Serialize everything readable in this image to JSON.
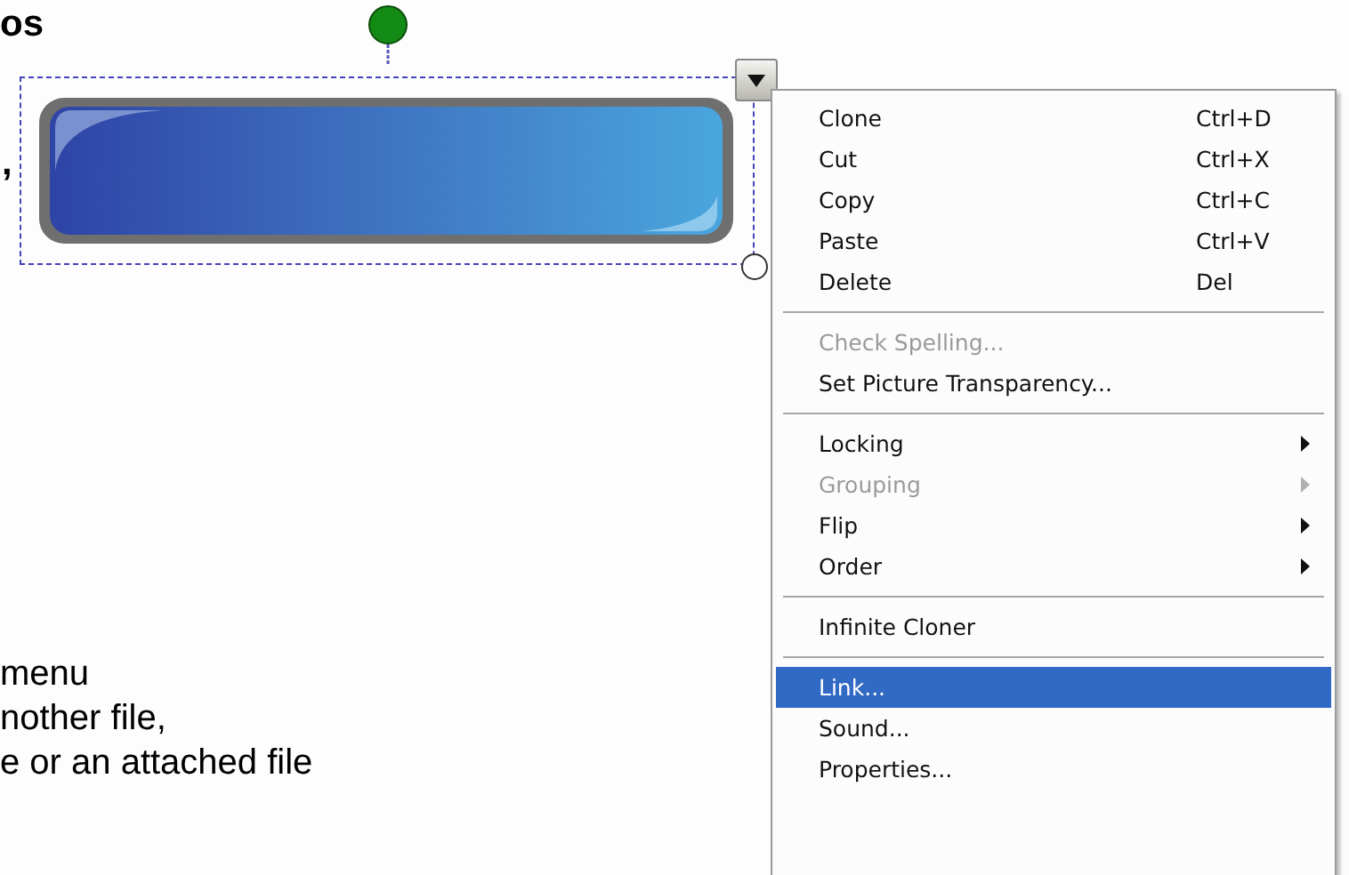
{
  "slide": {
    "texts": [
      {
        "kind": "heading",
        "text": "os"
      },
      {
        "kind": "fragment",
        "text": ","
      },
      {
        "kind": "body",
        "text": "menu"
      },
      {
        "kind": "body",
        "text": "nother file,"
      },
      {
        "kind": "body",
        "text": "e or an attached file"
      }
    ]
  },
  "context_menu": {
    "items": [
      {
        "kind": "item",
        "label": "Clone",
        "shortcut": "Ctrl+D",
        "disabled": false,
        "selected": false,
        "submenu": false
      },
      {
        "kind": "item",
        "label": "Cut",
        "shortcut": "Ctrl+X",
        "disabled": false,
        "selected": false,
        "submenu": false
      },
      {
        "kind": "item",
        "label": "Copy",
        "shortcut": "Ctrl+C",
        "disabled": false,
        "selected": false,
        "submenu": false
      },
      {
        "kind": "item",
        "label": "Paste",
        "shortcut": "Ctrl+V",
        "disabled": false,
        "selected": false,
        "submenu": false
      },
      {
        "kind": "item",
        "label": "Delete",
        "shortcut": "Del",
        "disabled": false,
        "selected": false,
        "submenu": false
      },
      {
        "kind": "separator"
      },
      {
        "kind": "item",
        "label": "Check Spelling...",
        "disabled": true,
        "selected": false,
        "submenu": false
      },
      {
        "kind": "item",
        "label": "Set Picture Transparency...",
        "disabled": false,
        "selected": false,
        "submenu": false
      },
      {
        "kind": "separator"
      },
      {
        "kind": "item",
        "label": "Locking",
        "disabled": false,
        "selected": false,
        "submenu": true
      },
      {
        "kind": "item",
        "label": "Grouping",
        "disabled": true,
        "selected": false,
        "submenu": true
      },
      {
        "kind": "item",
        "label": "Flip",
        "disabled": false,
        "selected": false,
        "submenu": true
      },
      {
        "kind": "item",
        "label": "Order",
        "disabled": false,
        "selected": false,
        "submenu": true
      },
      {
        "kind": "separator"
      },
      {
        "kind": "item",
        "label": "Infinite Cloner",
        "disabled": false,
        "selected": false,
        "submenu": false
      },
      {
        "kind": "separator"
      },
      {
        "kind": "item",
        "label": "Link...",
        "disabled": false,
        "selected": true,
        "submenu": false
      },
      {
        "kind": "item",
        "label": "Sound...",
        "disabled": false,
        "selected": false,
        "submenu": false
      },
      {
        "kind": "item",
        "label": "Properties...",
        "disabled": false,
        "selected": false,
        "submenu": false
      }
    ]
  }
}
